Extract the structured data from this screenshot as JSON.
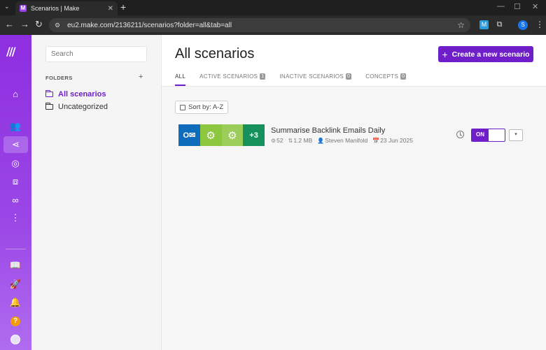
{
  "browser": {
    "tab_title": "Scenarios | Make",
    "url": "eu2.make.com/2136211/scenarios?folder=all&tab=all",
    "profile_initial": "S"
  },
  "rail": {
    "icons": [
      "home-icon",
      "team-icon",
      "scenarios-icon",
      "connections-icon",
      "apps-icon",
      "webhooks-icon",
      "more-icon",
      "docs-icon",
      "launch-icon",
      "notifications-icon",
      "help-icon",
      "avatar"
    ],
    "help_label": "?"
  },
  "folders": {
    "search_placeholder": "Search",
    "heading": "FOLDERS",
    "add_label": "+",
    "items": [
      {
        "label": "All scenarios",
        "active": true
      },
      {
        "label": "Uncategorized",
        "active": false
      }
    ]
  },
  "main": {
    "title": "All scenarios",
    "create_label": "Create a new scenario",
    "tabs": [
      {
        "label": "ALL",
        "count": ""
      },
      {
        "label": "ACTIVE SCENARIOS",
        "count": "1"
      },
      {
        "label": "INACTIVE SCENARIOS",
        "count": "0"
      },
      {
        "label": "CONCEPTS",
        "count": "0"
      }
    ],
    "sort_label": "Sort by: A-Z",
    "scenarios": [
      {
        "name": "Summarise Backlink Emails Daily",
        "operations": "52",
        "data_size": "1.2 MB",
        "owner": "Steven Manifold",
        "date": "23 Jun 2025",
        "extra_modules": "+3",
        "status_label": "ON"
      }
    ]
  },
  "colors": {
    "accent": "#6f1ec9",
    "rail": "#8d2ee0",
    "outlook": "#0f6cbd",
    "tools": "#8dc63f",
    "more_modules": "#17915c"
  }
}
